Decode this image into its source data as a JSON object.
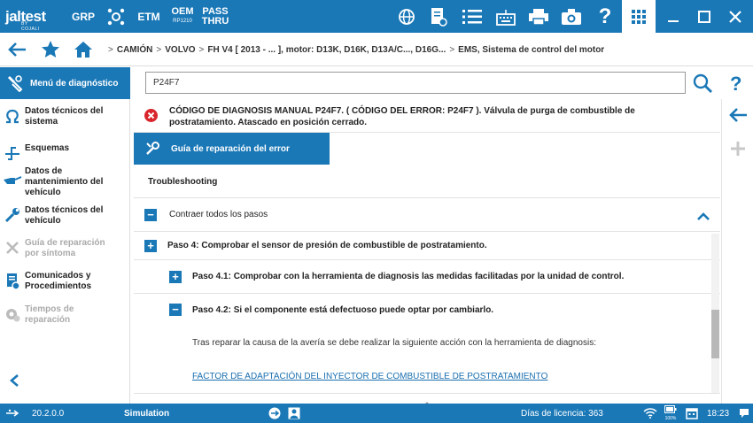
{
  "topbar": {
    "logo": "jaltest",
    "logo_sub": "BY COJALI",
    "grp": "GRP",
    "etm": "ETM",
    "oem_line1": "OEM",
    "oem_line2": "RP1210",
    "pass_line1": "PASS",
    "pass_line2": "THRU"
  },
  "breadcrumb": [
    "CAMIÓN",
    "VOLVO",
    "FH V4 [ 2013 - ... ], motor: D13K, D16K, D13A/C..., D16G...",
    "EMS, Sistema de control del motor"
  ],
  "sidebar": {
    "active": "Menú de diagnóstico",
    "items": [
      {
        "label": "Datos técnicos del sistema",
        "icon": "omega-icon",
        "disabled": false
      },
      {
        "label": "Esquemas",
        "icon": "schematic-icon",
        "disabled": false
      },
      {
        "label": "Datos de mantenimiento del vehículo",
        "icon": "oil-can-icon",
        "disabled": false
      },
      {
        "label": "Datos técnicos del vehículo",
        "icon": "wrench-icon",
        "disabled": false
      },
      {
        "label": "Guía de reparación por síntoma",
        "icon": "repair-tools-icon",
        "disabled": true
      },
      {
        "label": "Comunicados y Procedimientos",
        "icon": "documents-icon",
        "disabled": false
      },
      {
        "label": "Tiempos de reparación",
        "icon": "gear-clock-icon",
        "disabled": true
      }
    ]
  },
  "search": {
    "value": "P24F7"
  },
  "error": {
    "text": "CÓDIGO DE DIAGNOSIS MANUAL P24F7. ( CÓDIGO DEL ERROR: P24F7 ). Válvula de purga de combustible de postratamiento. Atascado en posición cerrado."
  },
  "guide_button": "Guía de reparación del error",
  "troubleshooting": "Troubleshooting",
  "collapse_all": "Contraer todos los pasos",
  "steps": {
    "step4": "Paso 4: Comprobar el sensor de presión de combustible de postratamiento.",
    "step41": "Paso 4.1: Comprobar con la herramienta de diagnosis las medidas facilitadas por la unidad de control.",
    "step42": "Paso 4.2: Si el componente está defectuoso puede optar por cambiarlo.",
    "step42_body": "Tras reparar la causa de la avería se debe realizar la siguiente acción con la herramienta de diagnosis:",
    "step42_link": "FACTOR DE ADAPTACIÓN DEL INYECTOR DE COMBUSTIBLE DE POSTRATAMIENTO"
  },
  "statusbar": {
    "version": "20.2.0.0",
    "mode": "Simulation",
    "license": "Días de licencia: 363",
    "battery": "100%",
    "time": "18:23"
  },
  "colors": {
    "primary": "#1a78b7",
    "error": "#d9262c"
  }
}
